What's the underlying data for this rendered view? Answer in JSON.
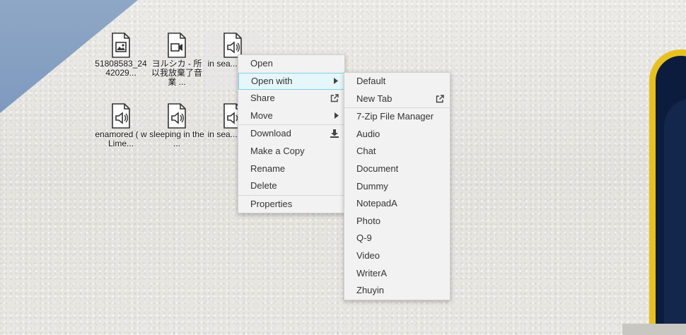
{
  "desktop": {
    "icons": [
      {
        "label": "51808583_2442029...",
        "icon": "image-file-icon"
      },
      {
        "label": "ヨルシカ - 所以我放棄了音業 ...",
        "icon": "video-file-icon"
      },
      {
        "label": "in sea... spl...",
        "icon": "audio-file-icon"
      },
      {
        "label": "enamored ( w Lime...",
        "icon": "audio-file-icon"
      },
      {
        "label": "sleeping in the ...",
        "icon": "audio-file-icon"
      },
      {
        "label": "in sea... spl...",
        "icon": "audio-file-icon"
      }
    ]
  },
  "context_menu": {
    "items": [
      {
        "label": "Open"
      },
      {
        "label": "Open with",
        "trail": "submenu-arrow-icon"
      },
      {
        "label": "Share",
        "trail": "external-link-icon"
      },
      {
        "label": "Move",
        "trail": "submenu-arrow-icon"
      },
      {
        "label": "Download",
        "trail": "download-icon"
      },
      {
        "label": "Make a Copy"
      },
      {
        "label": "Rename"
      },
      {
        "label": "Delete"
      },
      {
        "label": "Properties"
      }
    ]
  },
  "submenu": {
    "items": [
      {
        "label": "Default"
      },
      {
        "label": "New Tab",
        "trail": "external-link-icon"
      },
      {
        "label": "7-Zip File Manager"
      },
      {
        "label": "Audio"
      },
      {
        "label": "Chat"
      },
      {
        "label": "Document"
      },
      {
        "label": "Dummy"
      },
      {
        "label": "NotepadA"
      },
      {
        "label": "Photo"
      },
      {
        "label": "Q-9"
      },
      {
        "label": "Video"
      },
      {
        "label": "WriterA"
      },
      {
        "label": "Zhuyin"
      }
    ]
  },
  "colors": {
    "menu_bg": "#f2f2f2",
    "highlight_bg": "#e6f7fb",
    "highlight_border": "#7fd0ea",
    "window_frame": "#e7c11f"
  }
}
